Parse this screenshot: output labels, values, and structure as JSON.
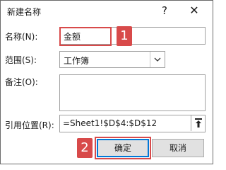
{
  "dialog": {
    "title": "新建名称",
    "help_glyph": "?",
    "close_glyph": "✕"
  },
  "form": {
    "name_label": "名称(N):",
    "name_value": "金额",
    "scope_label": "范围(S):",
    "scope_value": "工作簿",
    "comment_label": "备注(O):",
    "comment_value": "",
    "refers_label": "引用位置(R):",
    "refers_value": "=Sheet1!$D$4:$D$12"
  },
  "buttons": {
    "ok": "确定",
    "cancel": "取消"
  },
  "callouts": {
    "step1": "1",
    "step2": "2",
    "highlight_color": "#d84a4a"
  },
  "colors": {
    "accent": "#0078d7"
  }
}
